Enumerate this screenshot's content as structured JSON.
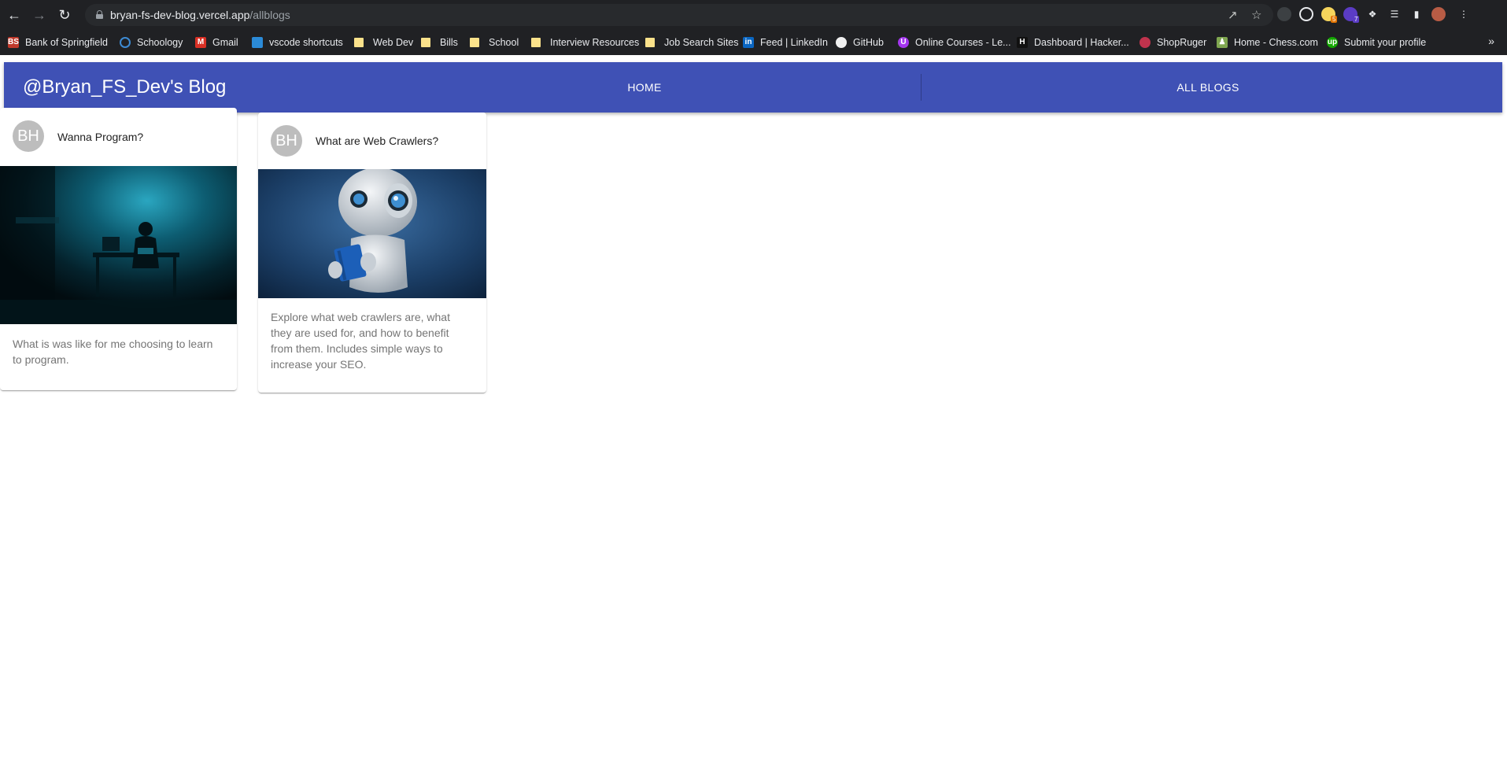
{
  "browser": {
    "url_host": "bryan-fs-dev-blog.vercel.app",
    "url_path": "/allblogs",
    "extension_badges": [
      "5",
      "7"
    ]
  },
  "bookmarks": [
    {
      "label": "Bank of Springfield",
      "icon": "bank-favicon",
      "icon_text": "BS",
      "color": "#c0392b"
    },
    {
      "label": "Schoology",
      "icon": "schoology-favicon",
      "icon_text": "",
      "color": "#3d8bd4"
    },
    {
      "label": "Gmail",
      "icon": "gmail-favicon",
      "icon_text": "M",
      "color": "#d93025"
    },
    {
      "label": "vscode shortcuts",
      "icon": "vscode-favicon",
      "icon_text": "",
      "color": "#2b8bd8"
    },
    {
      "label": "Web Dev",
      "icon": "folder-icon"
    },
    {
      "label": "Bills",
      "icon": "folder-icon"
    },
    {
      "label": "School",
      "icon": "folder-icon"
    },
    {
      "label": "Interview Resources",
      "icon": "folder-icon"
    },
    {
      "label": "Job Search Sites",
      "icon": "folder-icon"
    },
    {
      "label": "Feed | LinkedIn",
      "icon": "linkedin-favicon",
      "icon_text": "in",
      "color": "#0a66c2"
    },
    {
      "label": "GitHub",
      "icon": "github-favicon",
      "icon_text": "",
      "color": "#f0f0f0"
    },
    {
      "label": "Online Courses - Le...",
      "icon": "udemy-favicon",
      "icon_text": "U",
      "color": "#a435f0"
    },
    {
      "label": "Dashboard | Hacker...",
      "icon": "hackerrank-favicon",
      "icon_text": "H",
      "color": "#111111"
    },
    {
      "label": "ShopRuger",
      "icon": "ruger-favicon",
      "icon_text": "",
      "color": "#c0334d"
    },
    {
      "label": "Home - Chess.com",
      "icon": "chess-favicon",
      "icon_text": "♟",
      "color": "#7fa650"
    },
    {
      "label": "Submit your profile",
      "icon": "upwork-favicon",
      "icon_text": "up",
      "color": "#14a800"
    }
  ],
  "header": {
    "brand": "@Bryan_FS_Dev's Blog",
    "tabs": [
      "HOME",
      "ALL BLOGS"
    ],
    "color": "#3f51b5"
  },
  "posts": [
    {
      "avatar": "BH",
      "title": "Wanna Program?",
      "description": "What is was like for me choosing to learn to program.",
      "image": "dark-room-coder-image"
    },
    {
      "avatar": "BH",
      "title": "What are Web Crawlers?",
      "description": "Explore what web crawlers are, what they are used for, and how to benefit from them. Includes simple ways to increase your SEO.",
      "image": "robot-reading-book-image"
    }
  ]
}
